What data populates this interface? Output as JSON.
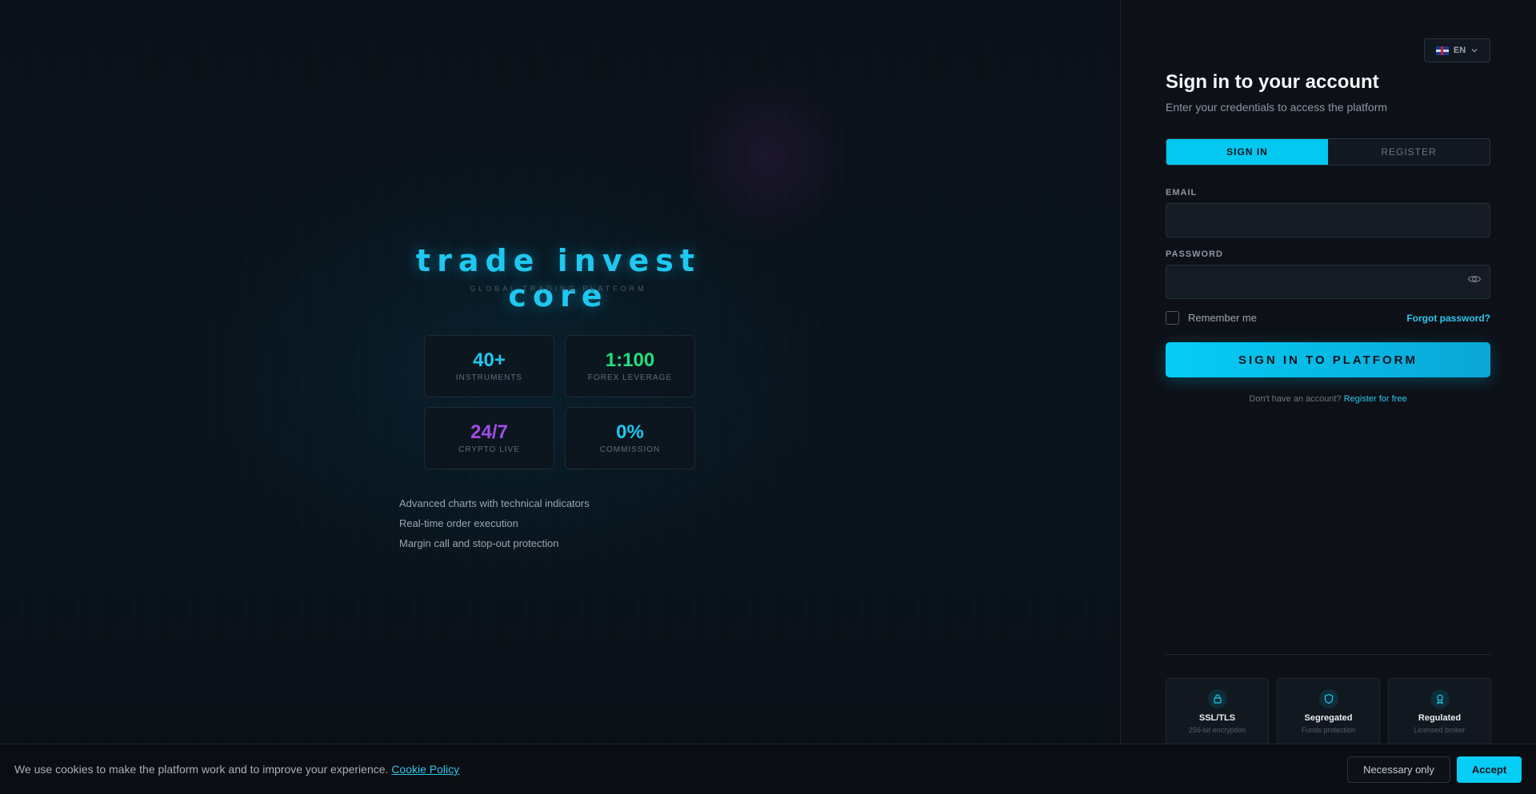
{
  "brand": {
    "name": "trade invest core",
    "tagline": "GLOBAL TRADING PLATFORM"
  },
  "stats": [
    {
      "value": "40+",
      "label": "INSTRUMENTS",
      "color": "#1ec8f0"
    },
    {
      "value": "1:100",
      "label": "FOREX LEVERAGE",
      "color": "#1fe07c"
    },
    {
      "value": "24/7",
      "label": "CRYPTO LIVE",
      "color": "#a24ce8"
    },
    {
      "value": "0%",
      "label": "COMMISSION",
      "color": "#1ec8f0"
    }
  ],
  "features": [
    "Advanced charts with technical indicators",
    "Real-time order execution",
    "Margin call and stop-out protection"
  ],
  "language": {
    "code": "EN",
    "icon": "uk-flag-icon"
  },
  "signin": {
    "title": "Sign in to your account",
    "subtitle": "Enter your credentials to access the platform",
    "tabs": [
      {
        "label": "SIGN IN",
        "active": true
      },
      {
        "label": "REGISTER",
        "active": false
      }
    ],
    "email_label": "EMAIL",
    "email_value": "",
    "password_label": "PASSWORD",
    "password_value": "",
    "remember_label": "Remember me",
    "forgot_label": "Forgot password?",
    "submit_label": "SIGN IN TO PLATFORM",
    "no_account_text": "Don't have an account?",
    "register_link": "Register for free"
  },
  "badges": [
    {
      "title": "SSL/TLS",
      "subtitle": "256-bit encryption",
      "icon": "lock-icon"
    },
    {
      "title": "Segregated",
      "subtitle": "Funds protection",
      "icon": "shield-icon"
    },
    {
      "title": "Regulated",
      "subtitle": "Licensed broker",
      "icon": "award-icon"
    }
  ],
  "cookie": {
    "text": "We use cookies to make the platform work and to improve your experience.",
    "link": "Cookie Policy",
    "necessary_label": "Necessary only",
    "accept_label": "Accept"
  },
  "colors": {
    "accent": "#05cdf5",
    "background": "#0b0e14"
  }
}
